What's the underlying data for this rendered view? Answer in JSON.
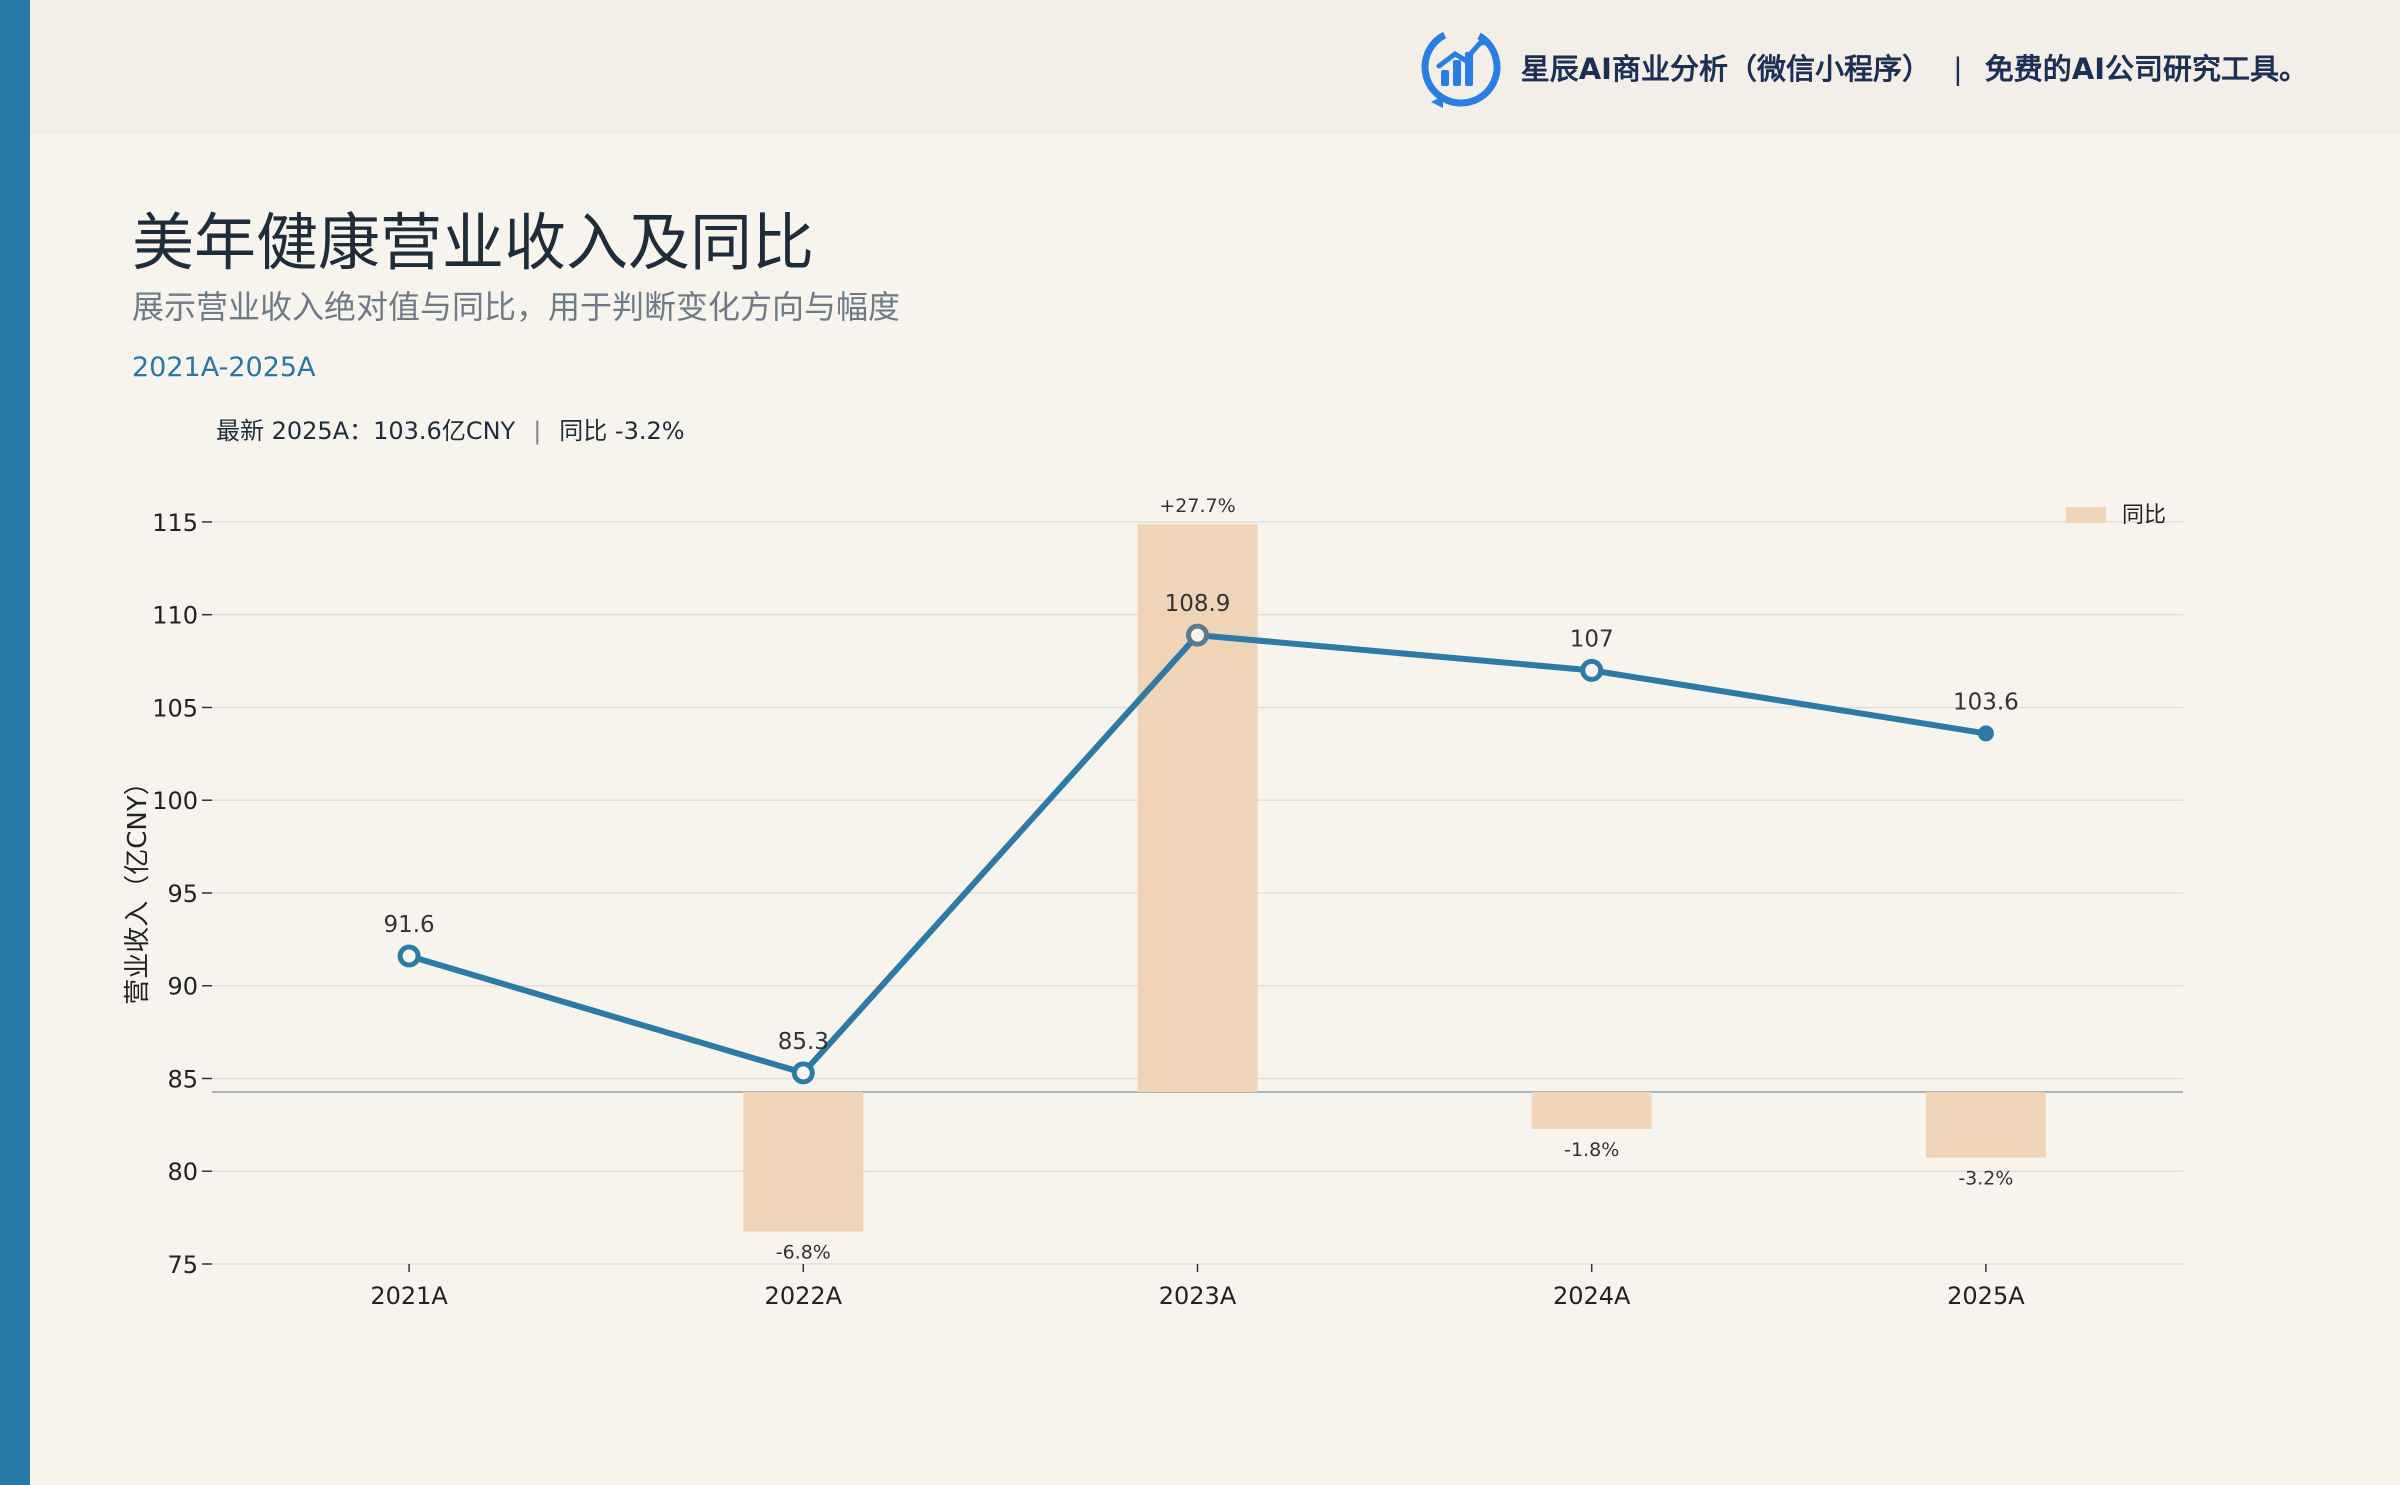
{
  "brand": {
    "name": "星辰AI商业分析（微信小程序）",
    "separator": "|",
    "slogan": "免费的AI公司研究工具。"
  },
  "header": {
    "title": "美年健康营业收入及同比",
    "subtitle": "展示营业收入绝对值与同比，用于判断变化方向与幅度",
    "period": "2021A-2025A"
  },
  "latest": {
    "value_text": "最新 2025A：103.6亿CNY",
    "separator": "|",
    "yoy_text": "同比 -3.2%"
  },
  "colors": {
    "accent": "#2878a6",
    "bar": "#efd4b8",
    "line": "#2d7aa5",
    "line_mid": "#5f7b8b",
    "background": "#f7f4ee"
  },
  "chart_data": {
    "type": "bar+line",
    "categories": [
      "2021A",
      "2022A",
      "2023A",
      "2024A",
      "2025A"
    ],
    "ylabel": "营业收入（亿CNY）",
    "ylim": [
      75,
      117.8
    ],
    "yticks": [
      75,
      80,
      85,
      90,
      95,
      100,
      105,
      110,
      115
    ],
    "grid": true,
    "legend_position": "top-right",
    "series": [
      {
        "name": "同比",
        "kind": "bar",
        "values": [
          null,
          -6.8,
          27.7,
          -1.8,
          -3.2
        ],
        "labels": [
          "",
          "-6.8%",
          "+27.7%",
          "-1.8%",
          "-3.2%"
        ]
      },
      {
        "kind": "line",
        "values": [
          91.6,
          85.3,
          108.9,
          107,
          103.6
        ],
        "labels": [
          "91.6",
          "85.3",
          "108.9",
          "107",
          "103.6"
        ]
      }
    ]
  }
}
